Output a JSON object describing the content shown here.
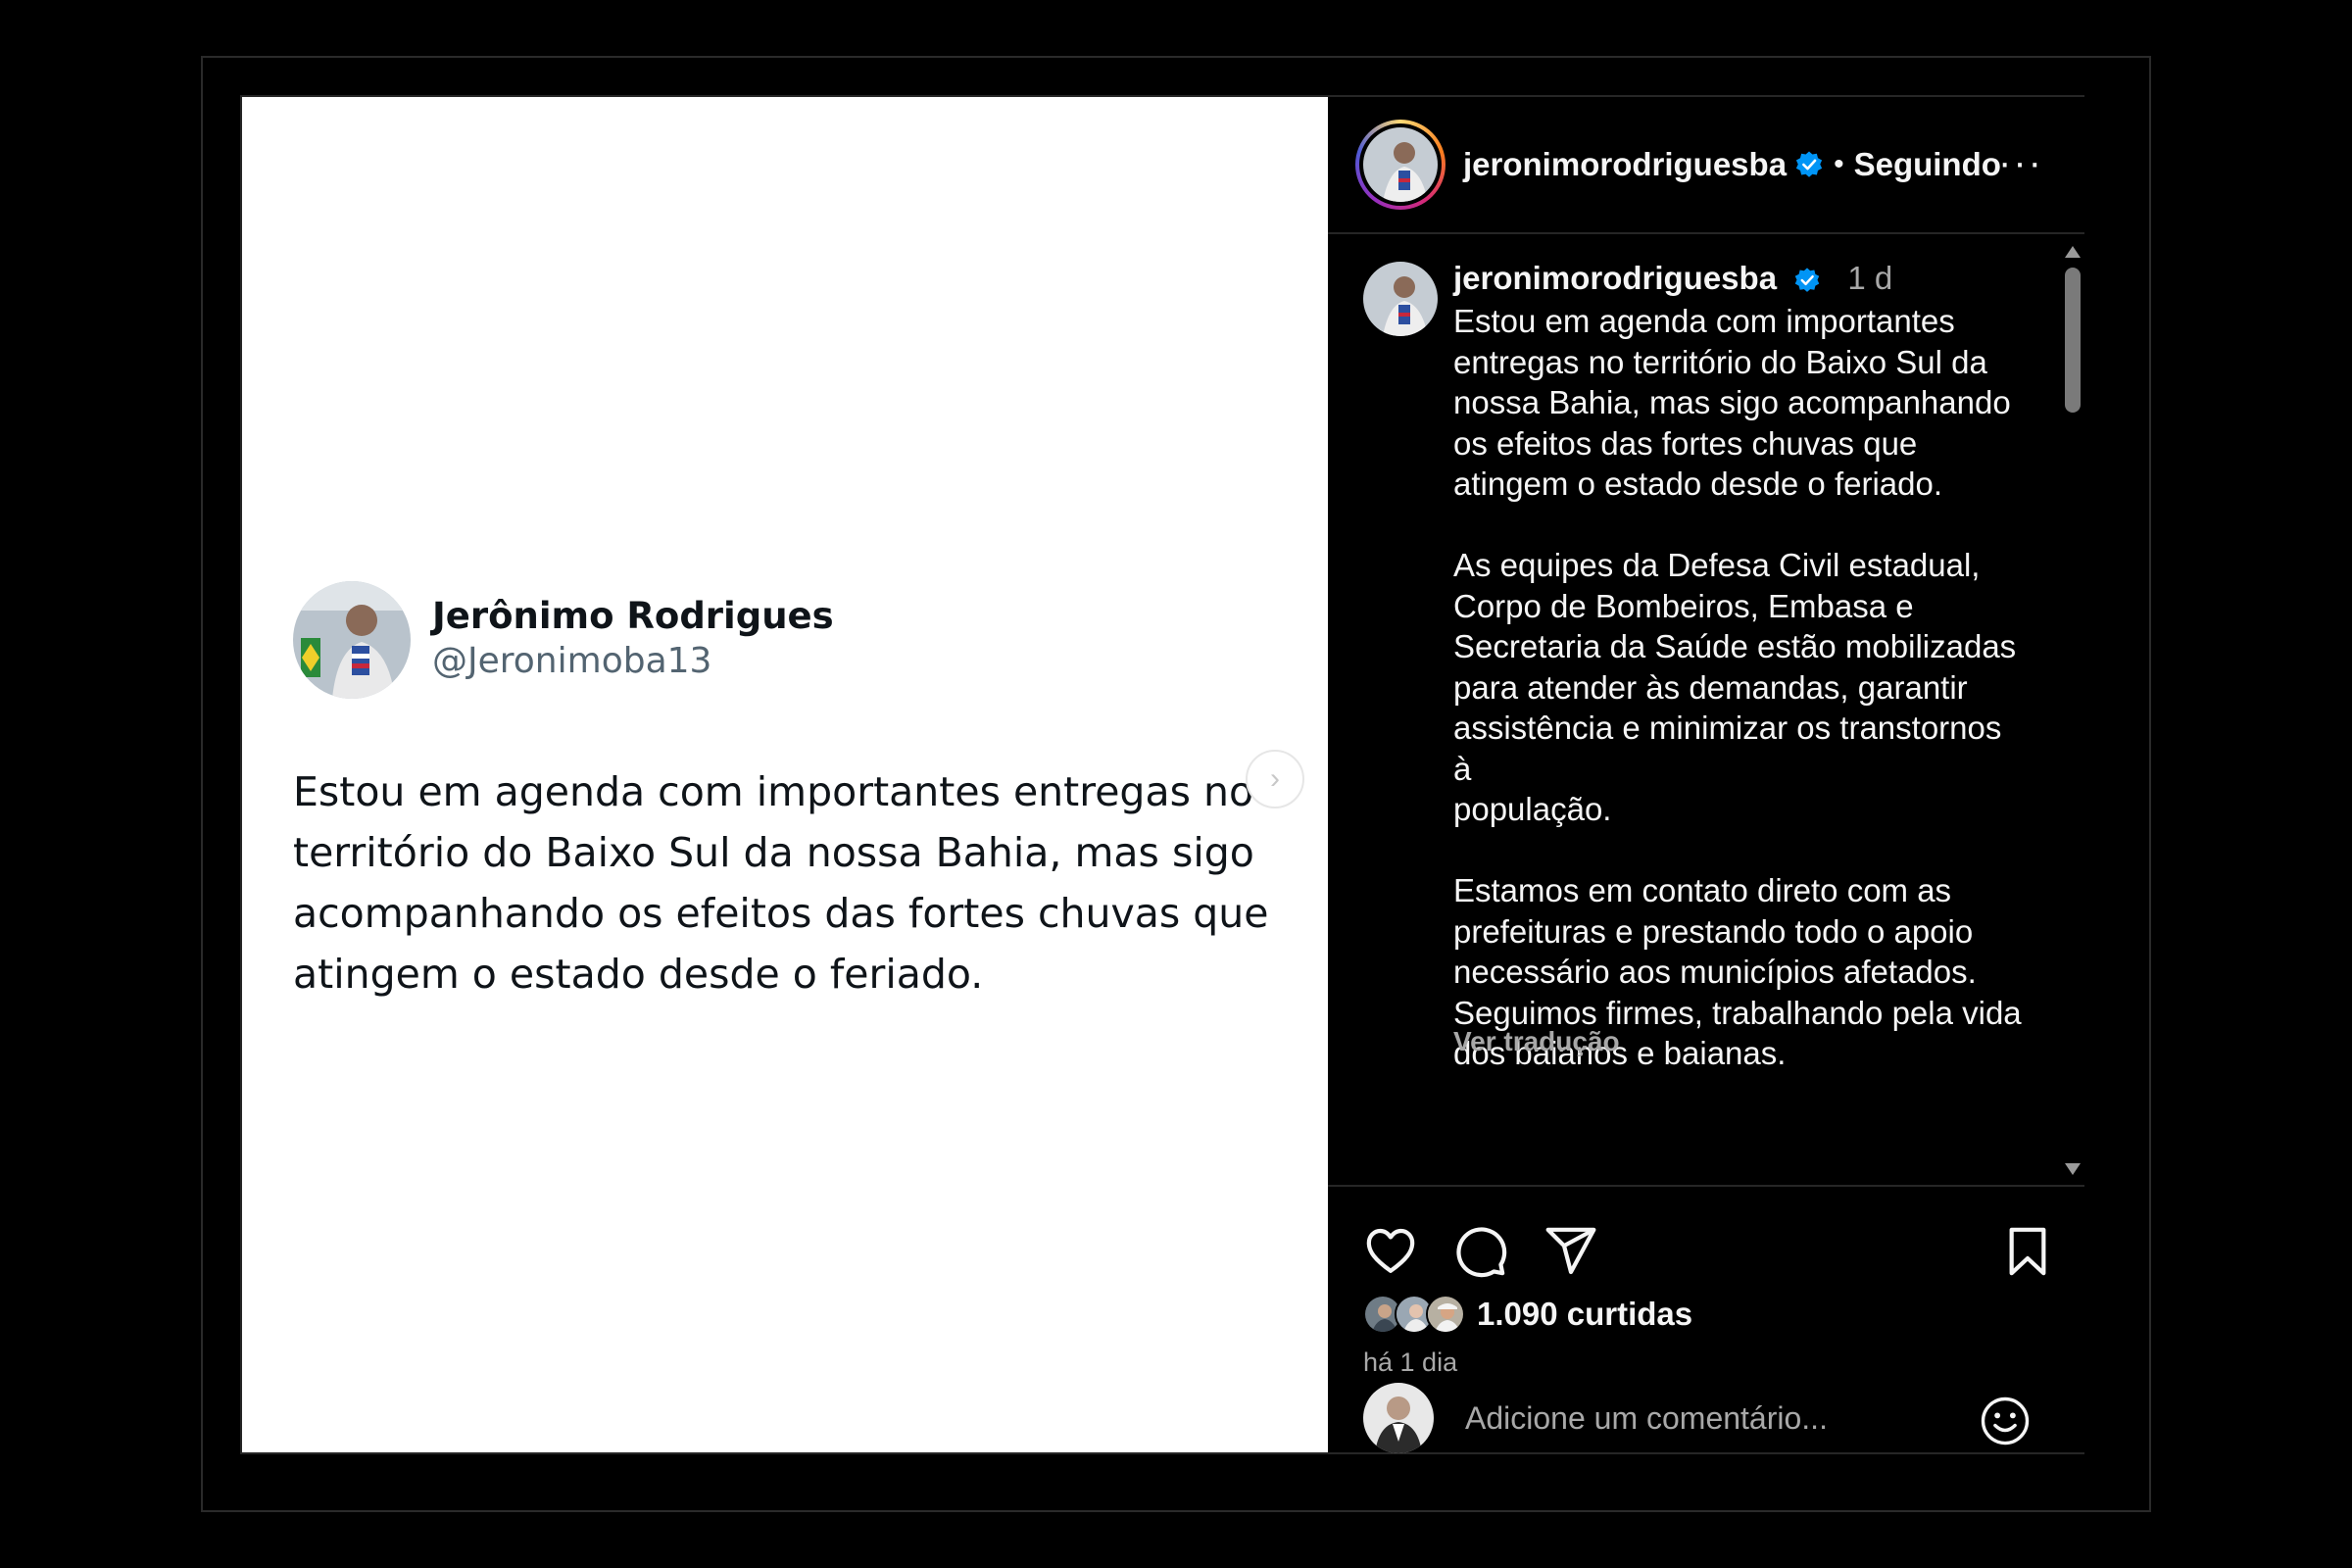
{
  "tweet": {
    "name": "Jerônimo Rodrigues",
    "handle": "@Jeronimoba13",
    "text": "Estou em agenda com importantes entregas no território do Baixo Sul da nossa Bahia, mas sigo acompanhando os efeitos das fortes chuvas que atingem o estado desde o feriado."
  },
  "header": {
    "username": "jeronimorodriguesba",
    "separator": "•",
    "follow_status": "Seguindo",
    "more": "···"
  },
  "caption": {
    "username": "jeronimorodriguesba",
    "time": "1 d",
    "text": "Estou em agenda com importantes\nentregas no território do Baixo Sul da\nnossa Bahia, mas sigo acompanhando\nos efeitos das fortes chuvas que\natingem o estado desde o feriado.\n\nAs equipes da Defesa Civil estadual,\nCorpo de Bombeiros, Embasa e\nSecretaria da Saúde estão mobilizadas\npara atender às demandas, garantir\nassistência e minimizar os transtornos à\npopulação.\n\nEstamos em contato direto com as\nprefeituras e prestando todo o apoio\nnecessário aos municípios afetados.\nSeguimos firmes, trabalhando pela vida\ndos baianos e baianas.",
    "translate": "Ver tradução"
  },
  "stats": {
    "likes": "1.090 curtidas",
    "ago": "há 1 dia"
  },
  "comment": {
    "placeholder": "Adicione um comentário..."
  },
  "colors": {
    "verified": "#0095f6",
    "background": "#000000",
    "text": "#f5f5f5",
    "muted": "#a8a8a8"
  },
  "icons": [
    "heart-icon",
    "comment-icon",
    "share-icon",
    "bookmark-icon",
    "emoji-icon",
    "verified-icon",
    "chevron-right-icon"
  ]
}
